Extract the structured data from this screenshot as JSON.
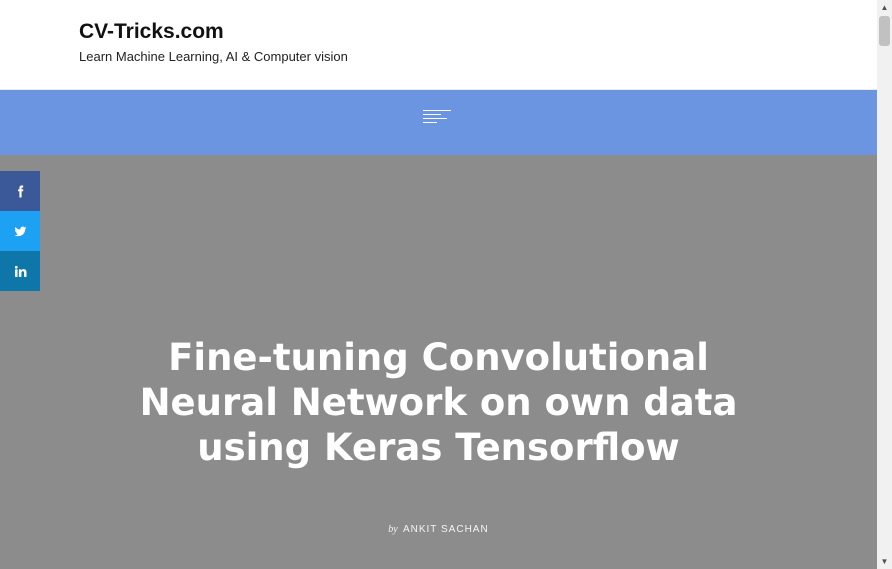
{
  "header": {
    "site_title": "CV-Tricks.com",
    "site_description": "Learn Machine Learning, AI & Computer vision"
  },
  "nav": {
    "menu_icon": "hamburger-menu-icon",
    "background_color": "#6b95e0"
  },
  "hero": {
    "title": "Fine-tuning Convolutional Neural Network on own data using Keras Tensorflow",
    "by_label": "by",
    "author": "ANKIT SACHAN",
    "background_color": "#8c8c8c"
  },
  "share": {
    "buttons": [
      {
        "icon": "facebook-icon",
        "color": "#3b5998"
      },
      {
        "icon": "twitter-icon",
        "color": "#1da1f2"
      },
      {
        "icon": "linkedin-icon",
        "color": "#0e76a8"
      }
    ]
  },
  "scrollbar": {
    "up_glyph": "▲",
    "down_glyph": "▼"
  }
}
